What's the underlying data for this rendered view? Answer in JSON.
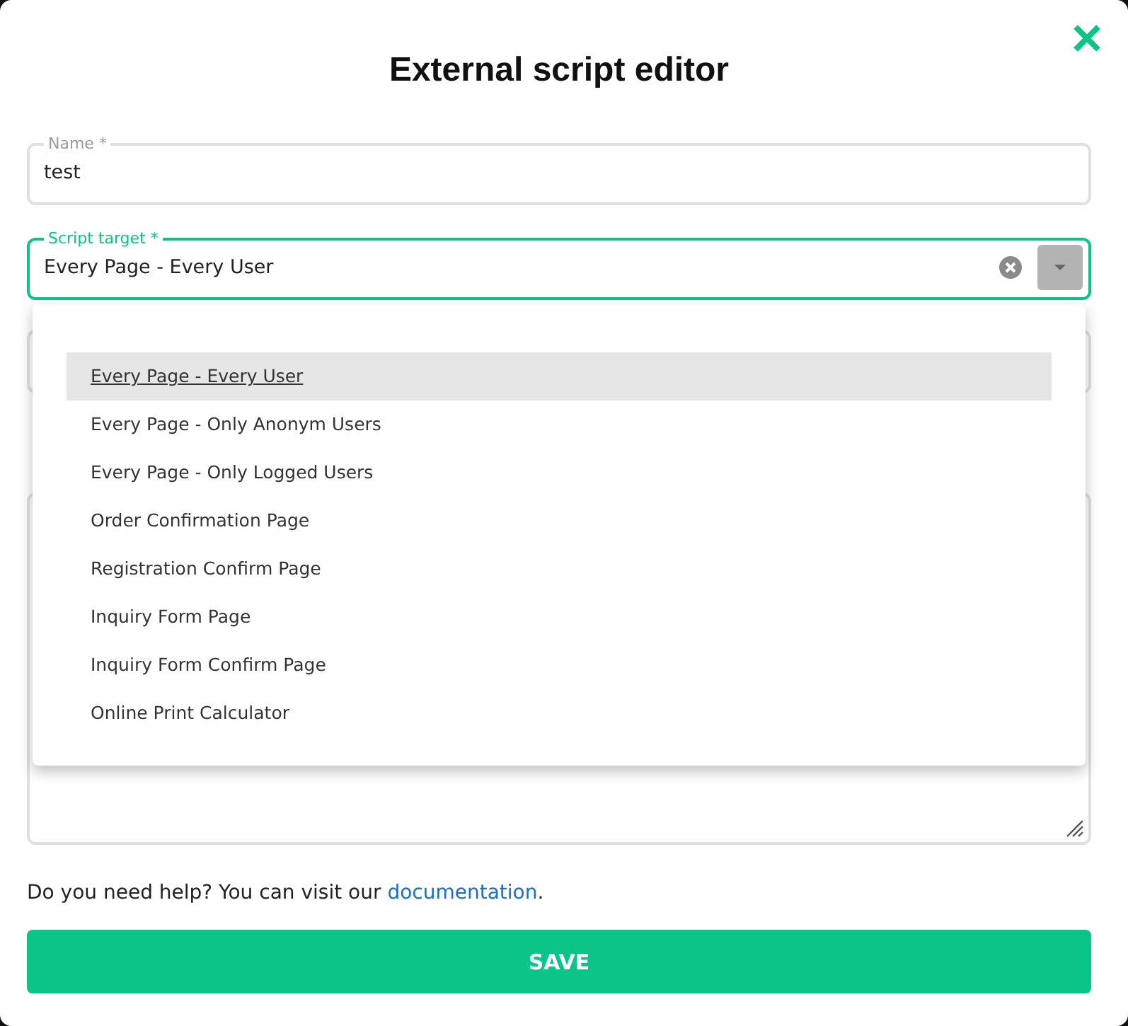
{
  "dialog": {
    "title": "External script editor"
  },
  "name_field": {
    "label": "Name *",
    "value": "test"
  },
  "target_field": {
    "label": "Script target *",
    "value": "Every Page - Every User",
    "focused": true,
    "expanded": true
  },
  "target_options": [
    {
      "label": "Every Page - Every User",
      "selected": true
    },
    {
      "label": "Every Page - Only Anonym Users",
      "selected": false
    },
    {
      "label": "Every Page - Only Logged Users",
      "selected": false
    },
    {
      "label": "Order Confirmation Page",
      "selected": false
    },
    {
      "label": "Registration Confirm Page",
      "selected": false
    },
    {
      "label": "Inquiry Form Page",
      "selected": false
    },
    {
      "label": "Inquiry Form Confirm Page",
      "selected": false
    },
    {
      "label": "Online Print Calculator",
      "selected": false
    }
  ],
  "help": {
    "text": "Do you need help? You can visit our ",
    "link": "documentation",
    "after": "."
  },
  "save_button": "SAVE"
}
